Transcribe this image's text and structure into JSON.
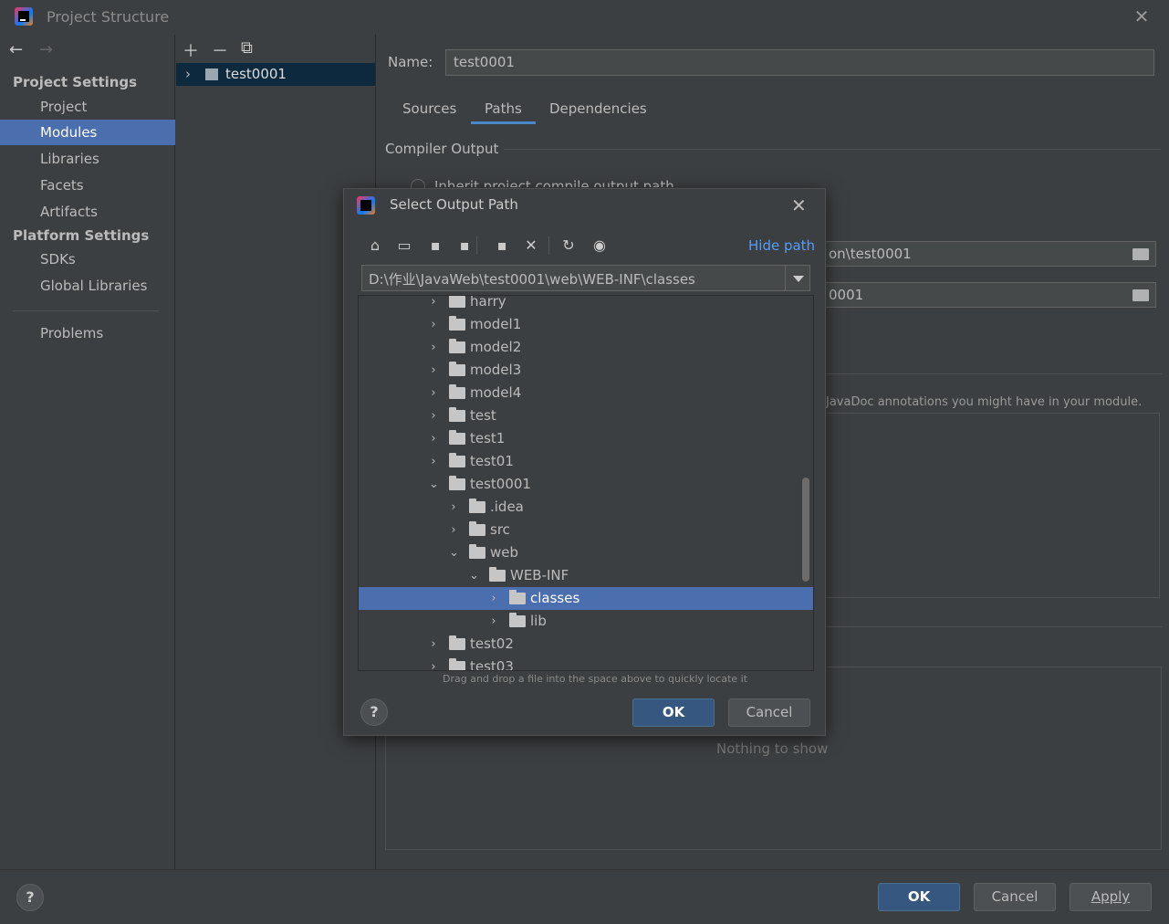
{
  "window": {
    "title": "Project Structure"
  },
  "nav": {
    "project_settings": "Project Settings",
    "items_project": [
      "Project",
      "Modules",
      "Libraries",
      "Facets",
      "Artifacts"
    ],
    "platform_settings": "Platform Settings",
    "items_platform": [
      "SDKs",
      "Global Libraries"
    ],
    "problems": "Problems"
  },
  "modules": {
    "item": "test0001"
  },
  "module": {
    "name_label": "Name:",
    "name_value": "test0001",
    "tabs": [
      "Sources",
      "Paths",
      "Dependencies"
    ],
    "selected_tab": "Paths",
    "compiler_output": "Compiler Output",
    "inherit_option": "Inherit project compile output path",
    "output_path_partial": "on\\test0001",
    "test_path_partial": "0001",
    "javadoc_text": "JavaDoc annotations you might have in your module.",
    "nothing_to_show": "Nothing to show"
  },
  "dialog": {
    "title": "Select Output Path",
    "hide_path": "Hide path",
    "path": "D:\\作业\\JavaWeb\\test0001\\web\\WEB-INF\\classes",
    "tree": [
      {
        "label": "harry",
        "depth": 0,
        "expanded": false
      },
      {
        "label": "model1",
        "depth": 0,
        "expanded": false
      },
      {
        "label": "model2",
        "depth": 0,
        "expanded": false
      },
      {
        "label": "model3",
        "depth": 0,
        "expanded": false
      },
      {
        "label": "model4",
        "depth": 0,
        "expanded": false
      },
      {
        "label": "test",
        "depth": 0,
        "expanded": false
      },
      {
        "label": "test1",
        "depth": 0,
        "expanded": false
      },
      {
        "label": "test01",
        "depth": 0,
        "expanded": false
      },
      {
        "label": "test0001",
        "depth": 0,
        "expanded": true
      },
      {
        "label": ".idea",
        "depth": 1,
        "expanded": false
      },
      {
        "label": "src",
        "depth": 1,
        "expanded": false
      },
      {
        "label": "web",
        "depth": 1,
        "expanded": true
      },
      {
        "label": "WEB-INF",
        "depth": 2,
        "expanded": true
      },
      {
        "label": "classes",
        "depth": 3,
        "expanded": false,
        "selected": true
      },
      {
        "label": "lib",
        "depth": 3,
        "expanded": false
      },
      {
        "label": "test02",
        "depth": 0,
        "expanded": false
      },
      {
        "label": "test03",
        "depth": 0,
        "expanded": false
      }
    ],
    "dnd_hint": "Drag and drop a file into the space above to quickly locate it",
    "ok": "OK",
    "cancel": "Cancel",
    "help": "?"
  },
  "footer": {
    "ok": "OK",
    "cancel": "Cancel",
    "apply": "Apply",
    "help": "?"
  },
  "colors": {
    "selection": "#4b6eaf",
    "accent_link": "#589df6",
    "primary_button": "#365880"
  }
}
